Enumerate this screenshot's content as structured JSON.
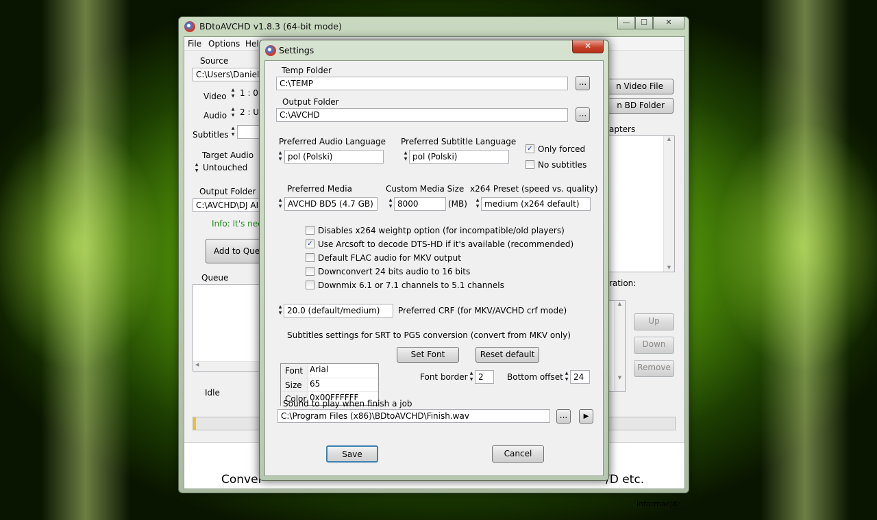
{
  "main": {
    "title": "BDtoAVCHD v1.8.3   (64-bit mode)",
    "menu": [
      "File",
      "Options",
      "Help"
    ],
    "source_label": "Source",
    "source_value": "C:\\Users\\Daniel\\",
    "video_label": "Video",
    "video_value": "1 :  0",
    "audio_label": "Audio",
    "audio_value": "2 :  U",
    "subtitles_label": "Subtitles",
    "target_audio_label": "Target Audio",
    "target_audio_value": "Untouched",
    "output_folder_label": "Output Folder",
    "output_folder_value": "C:\\AVCHD\\DJ AI",
    "info_text": "Info: It's nee",
    "add_queue": "Add to Que",
    "queue_label": "Queue",
    "status": "Idle",
    "open_video_file": "n Video File",
    "open_bd_folder": "n BD Folder",
    "chapters_label": "apters",
    "duration_label": "ration:",
    "up": "Up",
    "down": "Down",
    "remove": "Remove",
    "banner_left": "Conver",
    "banner_right": "/D etc.",
    "info_link": "Informacja",
    "progress_pct": 0.005,
    "colors": {
      "accent": "#f2c21b",
      "background": "#6fb514"
    }
  },
  "dialog": {
    "title": "Settings",
    "close": "✕",
    "temp_folder_label": "Temp Folder",
    "temp_folder_value": "C:\\TEMP",
    "output_folder_label": "Output Folder",
    "output_folder_value": "C:\\AVCHD",
    "browse": "...",
    "pref_audio_label": "Preferred Audio Language",
    "pref_audio_value": "pol (Polski)",
    "pref_sub_label": "Preferred Subtitle Language",
    "pref_sub_value": "pol (Polski)",
    "only_forced": "Only forced",
    "no_subtitles": "No subtitles",
    "pref_media_label": "Preferred Media",
    "pref_media_value": "AVCHD BD5 (4.7 GB)",
    "custom_size_label": "Custom Media Size",
    "custom_size_value": "8000",
    "mb": "(MB)",
    "x264_preset_label": "x264 Preset (speed vs. quality)",
    "x264_preset_value": "medium (x264 default)",
    "options": [
      {
        "label": "Disables x264 weightp option (for incompatible/old players)",
        "checked": false
      },
      {
        "label": "Use Arcsoft to decode DTS-HD if it's available (recommended)",
        "checked": true
      },
      {
        "label": "Default FLAC audio for MKV output",
        "checked": false
      },
      {
        "label": "Downconvert 24 bits audio to 16 bits",
        "checked": false
      },
      {
        "label": "Downmix 6.1 or 7.1 channels to 5.1 channels",
        "checked": false
      }
    ],
    "crf_value": "20.0 (default/medium)",
    "crf_label": "Preferred CRF (for MKV/AVCHD crf mode)",
    "sub_settings_label": "Subtitles settings for SRT to PGS conversion (convert from MKV only)",
    "font_rows": [
      {
        "key": "Font",
        "value": "Arial"
      },
      {
        "key": "Size",
        "value": "65"
      },
      {
        "key": "Color",
        "value": "0x00FFFFFF"
      }
    ],
    "set_font": "Set Font",
    "reset_default": "Reset default",
    "font_border_label": "Font border",
    "font_border_value": "2",
    "bottom_offset_label": "Bottom offset",
    "bottom_offset_value": "24",
    "sound_label": "Sound to play when finish a job",
    "sound_value": "C:\\Program Files (x86)\\BDtoAVCHD\\Finish.wav",
    "save": "Save",
    "cancel": "Cancel"
  }
}
